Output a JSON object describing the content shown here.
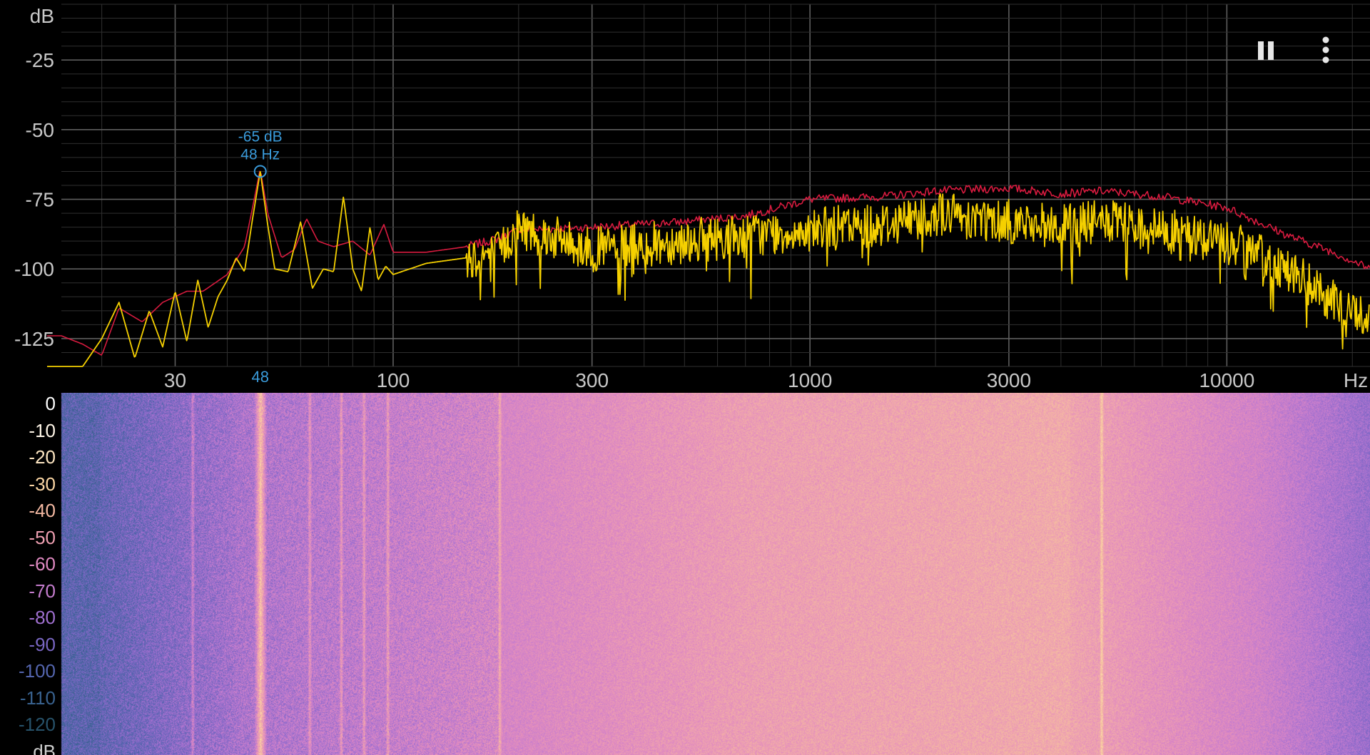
{
  "toolbar": {
    "pause_icon": "pause-icon",
    "menu_icon": "more-vert-icon"
  },
  "spectrum": {
    "y_unit": "dB",
    "x_unit": "Hz",
    "y_ticks": [
      "-25",
      "-50",
      "-75",
      "-100",
      "-125"
    ],
    "y_tick_values": [
      -25,
      -50,
      -75,
      -100,
      -125
    ],
    "x_ticks": [
      "30",
      "100",
      "300",
      "1000",
      "3000",
      "10000"
    ],
    "x_tick_values": [
      30,
      100,
      300,
      1000,
      3000,
      10000
    ],
    "x_range_hz": [
      16,
      22050
    ],
    "y_range_db": [
      -135,
      -5
    ],
    "peak": {
      "db_label": "-65 dB",
      "hz_label": "48 Hz",
      "axis_label": "48",
      "freq": 48,
      "db": -65
    },
    "colors": {
      "background": "#000000",
      "grid_major": "#5e5e5e",
      "grid_minor": "#2f2f2f",
      "live": "#f5d000",
      "hold": "#d81b3f",
      "marker": "#3a9ad9",
      "text": "#c8c8c8"
    }
  },
  "chart_data": {
    "type": "line",
    "xlabel": "Hz",
    "ylabel": "dB",
    "x_scale": "log",
    "xlim": [
      16,
      22050
    ],
    "ylim": [
      -135,
      -5
    ],
    "series": [
      {
        "color": "#d81b3f",
        "x": [
          16,
          18,
          20,
          22,
          25,
          28,
          32,
          35,
          40,
          44,
          46,
          48,
          50,
          54,
          58,
          62,
          66,
          72,
          80,
          88,
          95,
          100,
          120,
          150,
          180,
          200,
          300,
          500,
          700,
          1000,
          1500,
          2000,
          3000,
          4000,
          5000,
          7000,
          10000,
          14000,
          18000,
          22050
        ],
        "y": [
          -124,
          -127,
          -131,
          -114,
          -119,
          -112,
          -108,
          -108,
          -102,
          -92,
          -78,
          -64,
          -80,
          -96,
          -93,
          -82,
          -90,
          -92,
          -90,
          -95,
          -84,
          -94,
          -94,
          -92,
          -89,
          -86,
          -85,
          -83,
          -81,
          -75,
          -74,
          -72,
          -71,
          -73,
          -72,
          -74,
          -78,
          -88,
          -94,
          -100
        ]
      },
      {
        "color": "#f5d000",
        "x": [
          16,
          18,
          20,
          22,
          24,
          26,
          28,
          30,
          32,
          34,
          36,
          38,
          40,
          42,
          44,
          46,
          48,
          50,
          52,
          56,
          60,
          64,
          68,
          72,
          76,
          80,
          84,
          88,
          92,
          96,
          100,
          120,
          150,
          180,
          200,
          300,
          500,
          700,
          1000,
          1500,
          2000,
          3000,
          4000,
          5000,
          7000,
          10000,
          14000,
          18000,
          22050
        ],
        "y": [
          -135,
          -135,
          -125,
          -112,
          -132,
          -115,
          -128,
          -108,
          -126,
          -104,
          -121,
          -110,
          -104,
          -96,
          -101,
          -82,
          -65,
          -84,
          -100,
          -101,
          -83,
          -107,
          -100,
          -101,
          -74,
          -100,
          -108,
          -85,
          -104,
          -99,
          -102,
          -98,
          -96,
          -94,
          -85,
          -93,
          -90,
          -88,
          -86,
          -84,
          -80,
          -83,
          -85,
          -83,
          -86,
          -90,
          -100,
          -112,
          -118
        ]
      }
    ],
    "annotations": [
      "-65 dB",
      "48 Hz"
    ]
  },
  "spectrogram": {
    "scale_unit": "dB",
    "scale": [
      {
        "label": "0",
        "color": "#ffffff"
      },
      {
        "label": "-10",
        "color": "#fff6e8"
      },
      {
        "label": "-20",
        "color": "#fde6c2"
      },
      {
        "label": "-30",
        "color": "#fbd6a4"
      },
      {
        "label": "-40",
        "color": "#f4b9a2"
      },
      {
        "label": "-50",
        "color": "#ee9fb1"
      },
      {
        "label": "-60",
        "color": "#df89c1"
      },
      {
        "label": "-70",
        "color": "#c57dce"
      },
      {
        "label": "-80",
        "color": "#9f6fcf"
      },
      {
        "label": "-90",
        "color": "#7966c2"
      },
      {
        "label": "-100",
        "color": "#5465ae"
      },
      {
        "label": "-110",
        "color": "#39628f"
      },
      {
        "label": "-120",
        "color": "#27526a"
      }
    ],
    "unit_color": "#cfcfcf",
    "band_lines_hz": [
      33,
      48,
      63,
      75,
      85,
      97,
      180,
      5000
    ]
  }
}
